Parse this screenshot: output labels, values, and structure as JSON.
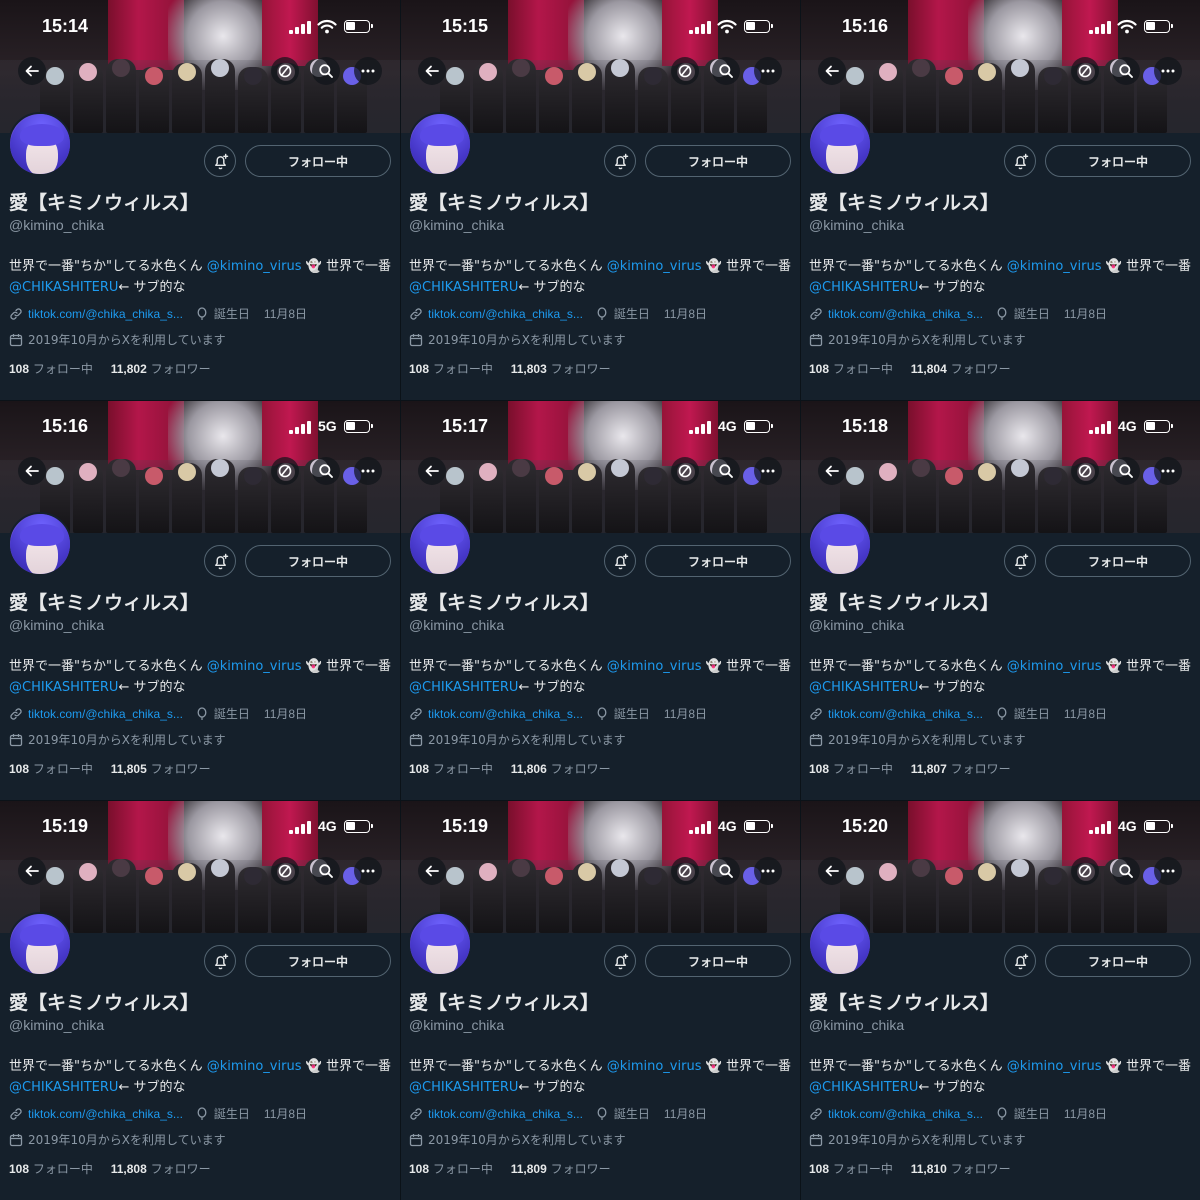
{
  "profile": {
    "display_name": "愛【キミノウィルス】",
    "handle": "@kimino_chika",
    "bio_prefix": "世界で一番\"ちか\"してる水色くん ",
    "bio_mention_1": "@kimino_virus",
    "bio_middle": " 世界で一番 ",
    "bio_mention_2": "@CHIKASHITERU",
    "bio_suffix": "← サブ的な",
    "link": "tiktok.com/@chika_chika_s...",
    "birthday_label": "誕生日",
    "birthday_value": "11月8日",
    "joined": "2019年10月からXを利用しています",
    "following_count": "108",
    "following_label": "フォロー中",
    "followers_label": "フォロワー",
    "follow_button": "フォロー中"
  },
  "colors": {
    "link": "#1d9bf0",
    "background": "#15202b",
    "muted": "#8b98a5"
  },
  "icons": [
    "back-arrow-icon",
    "no-notify-icon",
    "search-icon",
    "more-icon",
    "bell-plus-icon",
    "link-icon",
    "balloon-icon",
    "calendar-icon",
    "signal-icon",
    "wifi-icon",
    "battery-icon"
  ],
  "screens": [
    {
      "time": "15:14",
      "network": "wifi",
      "followers": "11,802"
    },
    {
      "time": "15:15",
      "network": "wifi",
      "followers": "11,803"
    },
    {
      "time": "15:16",
      "network": "wifi",
      "followers": "11,804"
    },
    {
      "time": "15:16",
      "network": "5G",
      "followers": "11,805"
    },
    {
      "time": "15:17",
      "network": "4G",
      "followers": "11,806"
    },
    {
      "time": "15:18",
      "network": "4G",
      "followers": "11,807"
    },
    {
      "time": "15:19",
      "network": "4G",
      "followers": "11,808"
    },
    {
      "time": "15:19",
      "network": "4G",
      "followers": "11,809"
    },
    {
      "time": "15:20",
      "network": "4G",
      "followers": "11,810"
    }
  ]
}
